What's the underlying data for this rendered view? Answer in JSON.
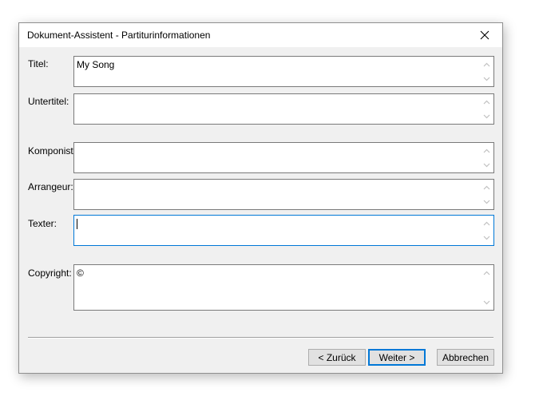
{
  "window": {
    "title": "Dokument-Assistent - Partiturinformationen"
  },
  "fields": [
    {
      "label": "Titel:",
      "value": "My Song"
    },
    {
      "label": "Untertitel:",
      "value": ""
    },
    {
      "label": "Komponist:",
      "value": ""
    },
    {
      "label": "Arrangeur:",
      "value": ""
    },
    {
      "label": "Texter:",
      "value": ""
    },
    {
      "label": "Copyright:",
      "value": "©"
    }
  ],
  "focused_field": "Texter:",
  "buttons": {
    "back": "< Zurück",
    "next": "Weiter >",
    "cancel": "Abbrechen"
  },
  "icons": {
    "close": "close-icon",
    "scroll_up": "chevron-up-icon",
    "scroll_down": "chevron-down-icon"
  },
  "colors": {
    "focus_border": "#0078d7",
    "dialog_bg": "#f0f0f0"
  }
}
